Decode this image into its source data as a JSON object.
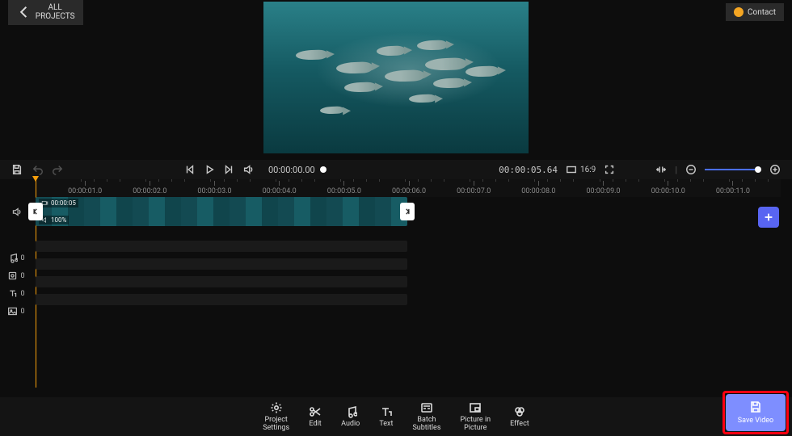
{
  "header": {
    "all_projects": "ALL PROJECTS",
    "contact": "Contact"
  },
  "controls": {
    "time_current": "00:00:00.00",
    "time_total": "00:00:05.64",
    "aspect": "16:9"
  },
  "ruler": [
    "00:00:01.0",
    "00:00:02.0",
    "00:00:03.0",
    "00:00:04.0",
    "00:00:05.0",
    "00:00:06.0",
    "00:00:07.0",
    "00:00:08.0",
    "00:00:09.0",
    "00:00:10.0",
    "00:00:11.0"
  ],
  "clip": {
    "duration_label": "00:00:05",
    "volume_label": "100%"
  },
  "side_tracks": {
    "music_count": "0",
    "sticker_count": "0",
    "text_count": "0",
    "image_count": "0"
  },
  "bottom": {
    "project_settings": "Project\nSettings",
    "edit": "Edit",
    "audio": "Audio",
    "text": "Text",
    "batch_subtitles": "Batch\nSubtitles",
    "pip": "Picture in\nPicture",
    "effect": "Effect",
    "save_video": "Save Video"
  }
}
